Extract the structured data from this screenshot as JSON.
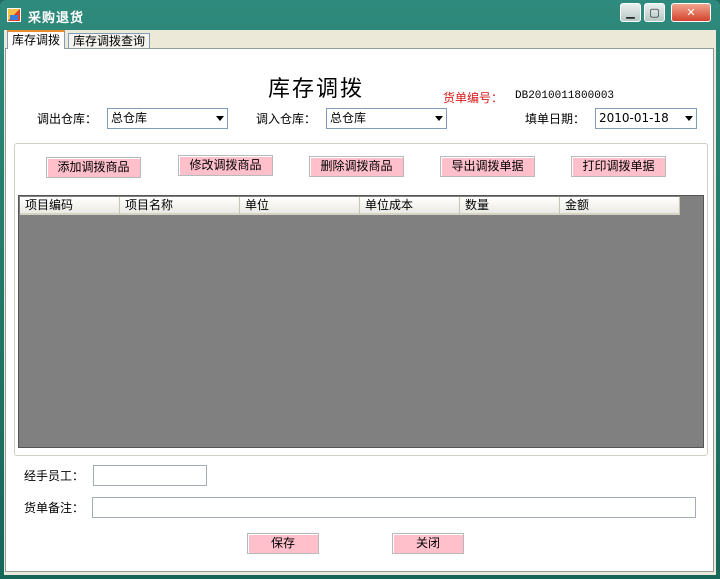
{
  "window": {
    "title": "采购退货",
    "icon": "app-icon",
    "controls": [
      "minimize-icon",
      "maximize-icon",
      "close-icon"
    ]
  },
  "tabs": [
    {
      "label": "库存调拨",
      "active": true
    },
    {
      "label": "库存调拨查询",
      "active": false
    }
  ],
  "form": {
    "heading": "库存调拨",
    "order_no_label": "货单编号：",
    "order_no_value": "DB2010011800003",
    "out_warehouse_label": "调出仓库：",
    "out_warehouse_value": "总仓库",
    "in_warehouse_label": "调入仓库：",
    "in_warehouse_value": "总仓库",
    "date_label": "填单日期：",
    "date_value": "2010-01-18",
    "handler_label": "经手员工：",
    "handler_value": "",
    "remark_label": "货单备注：",
    "remark_value": ""
  },
  "actions": {
    "add": "添加调拨商品",
    "edit": "修改调拨商品",
    "delete": "删除调拨商品",
    "export": "导出调拨单据",
    "print": "打印调拨单据"
  },
  "grid": {
    "columns": [
      "项目编码",
      "项目名称",
      "单位",
      "单位成本",
      "数量",
      "金额"
    ],
    "rows": []
  },
  "footer": {
    "save": "保存",
    "close": "关闭"
  },
  "colors": {
    "title_bar": "#1e6c62",
    "button_bg": "#ffc0cb",
    "order_label": "#d81b1b",
    "grid_bg": "#808080"
  }
}
